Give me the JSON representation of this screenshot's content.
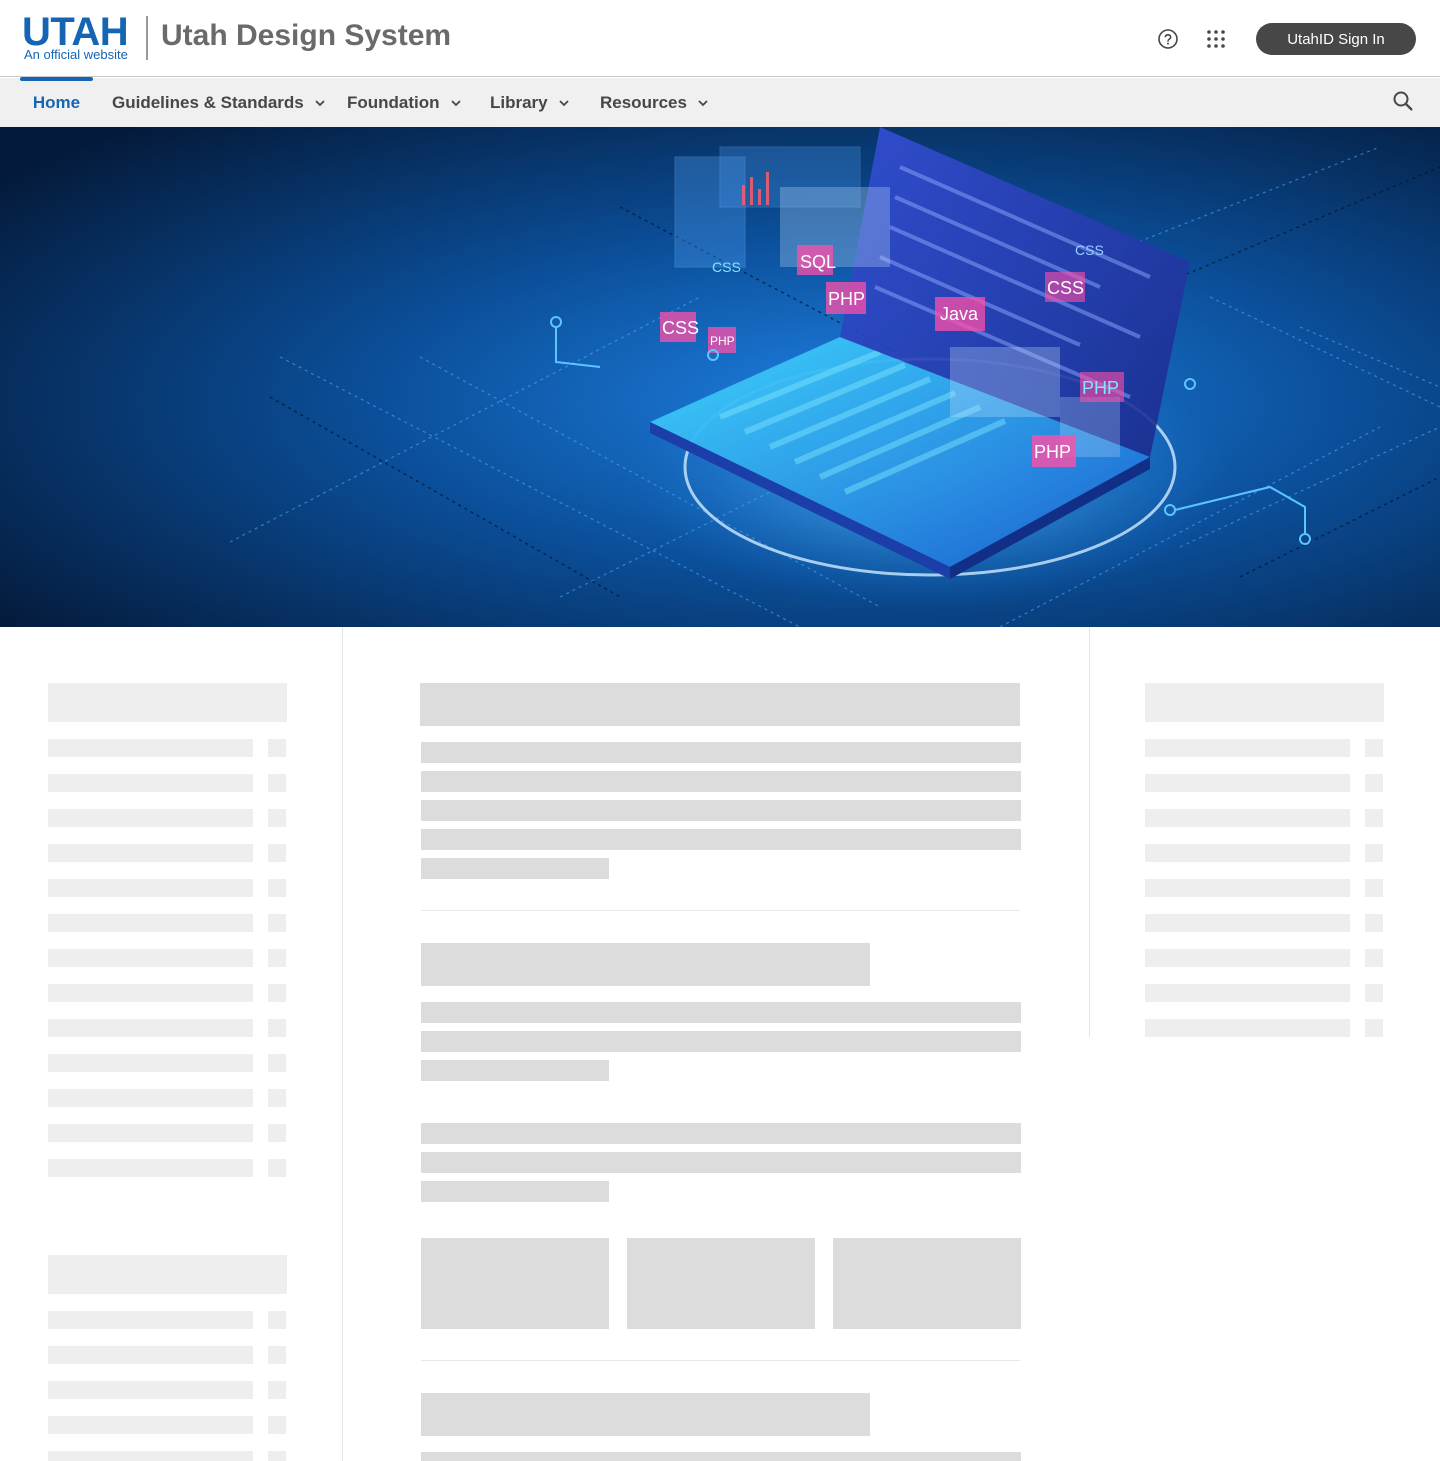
{
  "header": {
    "logo_word": "UTAH",
    "logo_sub": "An official website",
    "site_title": "Utah Design System",
    "help_icon": "help-circle-icon",
    "apps_icon": "grid-dots-icon",
    "signin_label": "UtahID Sign In"
  },
  "nav": {
    "items": [
      {
        "label": "Home",
        "active": true,
        "has_menu": false
      },
      {
        "label": "Guidelines & Standards",
        "active": false,
        "has_menu": true
      },
      {
        "label": "Foundation",
        "active": false,
        "has_menu": true
      },
      {
        "label": "Library",
        "active": false,
        "has_menu": true
      },
      {
        "label": "Resources",
        "active": false,
        "has_menu": true
      }
    ],
    "search_icon": "search-icon"
  },
  "hero": {
    "image": "isometric-laptop-code-illustration",
    "code_labels": [
      "CSS",
      "PHP",
      "SQL",
      "PHP",
      "Java",
      "CSS",
      "PHP",
      "PHP",
      "CSS",
      "CSS"
    ]
  },
  "colors": {
    "brand_blue": "#1565b4",
    "title_gray": "#6a6a6a",
    "nav_bg": "#f0f0f0",
    "signin_bg": "#474747",
    "skeleton": "#dcdcdc"
  },
  "content_state": "loading-skeleton"
}
